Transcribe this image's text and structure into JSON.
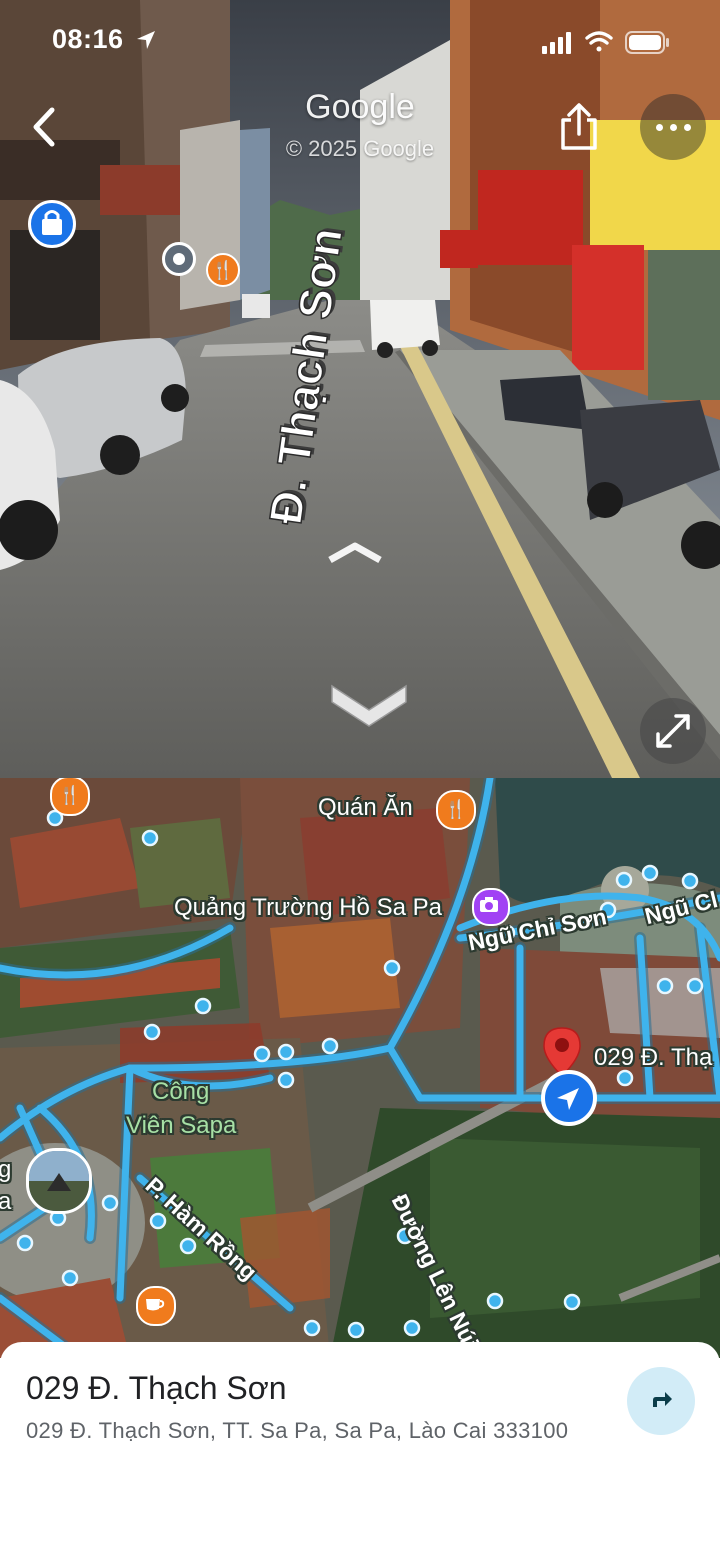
{
  "status_bar": {
    "time": "08:16",
    "icons": [
      "location-arrow-icon",
      "signal-icon",
      "wifi-icon",
      "battery-icon"
    ]
  },
  "street_view": {
    "logo": "Google",
    "copyright": "© 2025 Google",
    "road_label": "Đ. Thạch Sơn",
    "controls": [
      "back-icon",
      "share-icon",
      "more-icon",
      "expand-icon"
    ]
  },
  "map": {
    "labels": {
      "restaurant": "Quán Ăn",
      "square": "Quảng Trường Hồ Sa Pa",
      "road_ngu_chi_son": "Ngũ Chỉ Sơn",
      "road_ngu_chi_son_2": "Ngũ Cl",
      "park_line1": "Công",
      "park_line2": "Viên Sapa",
      "road_ham_rong": "P. Hàm Rồng",
      "road_len_nui": "Đường Lên Núi Hàm Rồng",
      "pin_address": "029 Đ. Thạ",
      "edge_left_1": "g",
      "edge_left_2": "a"
    },
    "colors": {
      "route": "#3fb3ec",
      "pin": "#e53935",
      "user_location": "#1a73e8"
    }
  },
  "place": {
    "title": "029 Đ. Thạch Sơn",
    "address": "029 Đ. Thạch Sơn, TT. Sa Pa, Sa Pa, Lào Cai 333100"
  }
}
